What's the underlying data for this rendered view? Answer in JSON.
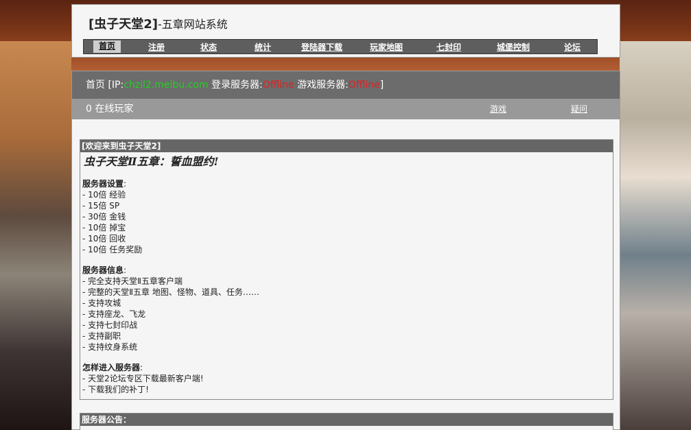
{
  "header": {
    "title_bold": "[虫子天堂2]",
    "title_rest": "-五章网站系统"
  },
  "nav": {
    "items": [
      {
        "label": "首页",
        "active": true
      },
      {
        "label": "注册"
      },
      {
        "label": "状态"
      },
      {
        "label": "统计"
      },
      {
        "label": "登陆器下载"
      },
      {
        "label": "玩家地图"
      },
      {
        "label": "七封印"
      },
      {
        "label": "城堡控制"
      },
      {
        "label": "论坛"
      }
    ]
  },
  "status": {
    "home": "首页",
    "ip_prefix": "[IP:",
    "ip": "chzil2.meibu.com",
    "login_label": "登录服务器:",
    "login_status": "Offline",
    "game_label": "游戏服务器:",
    "game_status": "Offline",
    "close": "]"
  },
  "online": {
    "text": "0 在线玩家",
    "link_game": "游戏",
    "link_faq": "疑问"
  },
  "welcome": {
    "head": "[欢迎来到虫子天堂2]",
    "slogan": "虫子天堂Ⅱ五章：誓血盟约!",
    "settings_title": "服务器设置",
    "settings": [
      "- 10倍 经验",
      "- 15倍 SP",
      "- 30倍 金钱",
      "- 10倍 掉宝",
      "- 10倍 回收",
      "- 10倍 任务奖励"
    ],
    "info_title": "服务器信息",
    "info": [
      "- 完全支持天堂Ⅱ五章客户端",
      "- 完整的天堂Ⅱ五章 地图、怪物、道具、任务……",
      "- 支持攻城",
      "- 支持座龙、飞龙",
      "- 支持七封印战",
      "- 支持副职",
      "- 支持纹身系统"
    ],
    "howto_title": "怎样进入服务器",
    "howto": [
      "- 天堂2论坛专区下载最新客户端!",
      "- 下载我们的补丁!"
    ]
  },
  "notice": {
    "head": "服务器公告："
  }
}
